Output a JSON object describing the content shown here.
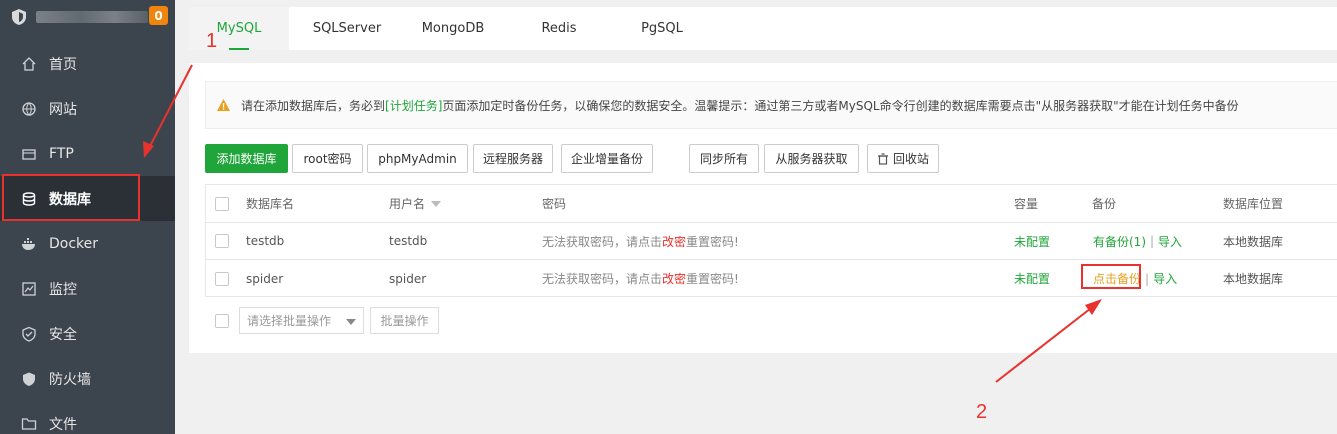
{
  "sidebar": {
    "badge": "0",
    "items": [
      {
        "label": "首页",
        "icon": "home-icon"
      },
      {
        "label": "网站",
        "icon": "globe-icon"
      },
      {
        "label": "FTP",
        "icon": "ftp-icon"
      },
      {
        "label": "数据库",
        "icon": "database-icon"
      },
      {
        "label": "Docker",
        "icon": "docker-icon"
      },
      {
        "label": "监控",
        "icon": "monitor-icon"
      },
      {
        "label": "安全",
        "icon": "shield-check-icon"
      },
      {
        "label": "防火墙",
        "icon": "firewall-icon"
      },
      {
        "label": "文件",
        "icon": "folder-icon"
      }
    ]
  },
  "tabs": [
    "MySQL",
    "SQLServer",
    "MongoDB",
    "Redis",
    "PgSQL"
  ],
  "notice": {
    "prefix": "请在添加数据库后，务必到",
    "link": "[计划任务]",
    "suffix": "页面添加定时备份任务，以确保您的数据安全。温馨提示：通过第三方或者MySQL命令行创建的数据库需要点击\"从服务器获取\"才能在计划任务中备份"
  },
  "toolbar": {
    "add_db": "添加数据库",
    "root_pwd": "root密码",
    "phpmyadmin": "phpMyAdmin",
    "remote": "远程服务器",
    "incremental": "企业增量备份",
    "sync_all": "同步所有",
    "fetch": "从服务器获取",
    "recycle": "回收站"
  },
  "table": {
    "headers": {
      "name": "数据库名",
      "user": "用户名",
      "password": "密码",
      "capacity": "容量",
      "backup": "备份",
      "location": "数据库位置"
    },
    "rows": [
      {
        "name": "testdb",
        "user": "testdb",
        "pwd_pre": "无法获取密码，请点击",
        "pwd_link": "改密",
        "pwd_post": "重置密码!",
        "capacity": "未配置",
        "backup": "有备份(1)",
        "import": "导入",
        "location": "本地数据库"
      },
      {
        "name": "spider",
        "user": "spider",
        "pwd_pre": "无法获取密码，请点击",
        "pwd_link": "改密",
        "pwd_post": "重置密码!",
        "capacity": "未配置",
        "backup": "点击备份",
        "import": "导入",
        "location": "本地数据库"
      }
    ]
  },
  "batch": {
    "placeholder": "请选择批量操作",
    "button": "批量操作"
  },
  "annotations": {
    "one": "1",
    "two": "2"
  }
}
